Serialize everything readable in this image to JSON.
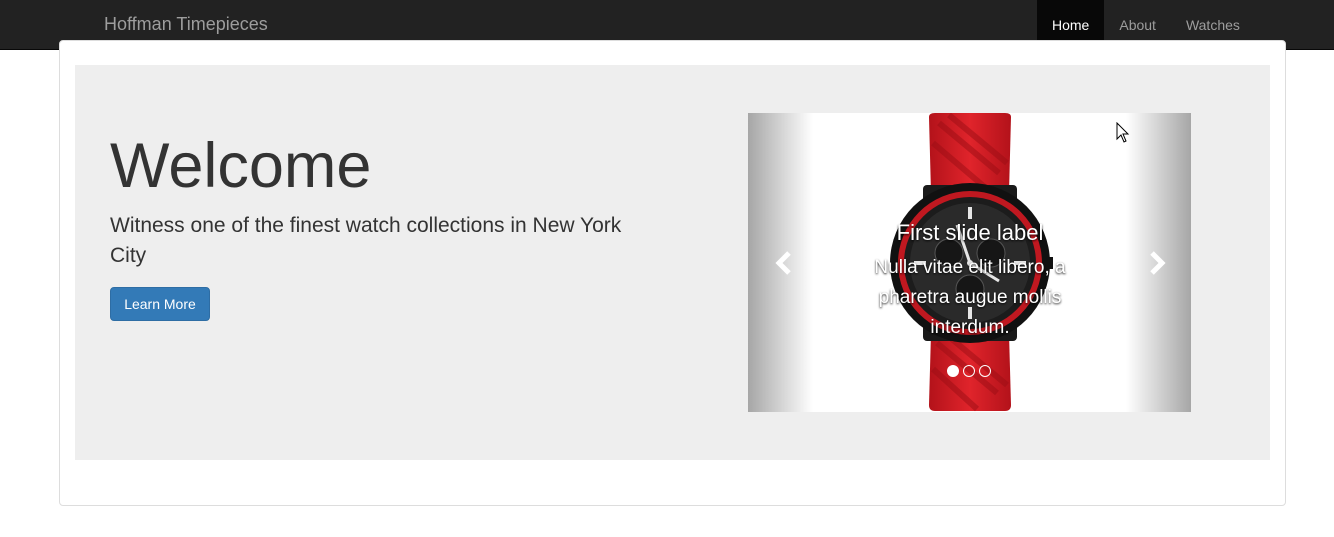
{
  "navbar": {
    "brand": "Hoffman Timepieces",
    "items": [
      {
        "label": "Home",
        "active": true
      },
      {
        "label": "About",
        "active": false
      },
      {
        "label": "Watches",
        "active": false
      }
    ]
  },
  "jumbotron": {
    "heading": "Welcome",
    "lead": "Witness one of the finest watch collections in New York City",
    "button_label": "Learn More"
  },
  "carousel": {
    "caption_title": "First slide label",
    "caption_text": "Nulla vitae elit libero, a pharetra augue mollis interdum.",
    "image": "red-watch-image",
    "indicators": [
      true,
      false,
      false
    ],
    "prev_icon": "chevron-left-icon",
    "next_icon": "chevron-right-icon"
  },
  "colors": {
    "navbar_bg": "#222222",
    "jumbotron_bg": "#eeeeee",
    "button_bg": "#337ab7",
    "watch_strap": "#d7191f"
  }
}
